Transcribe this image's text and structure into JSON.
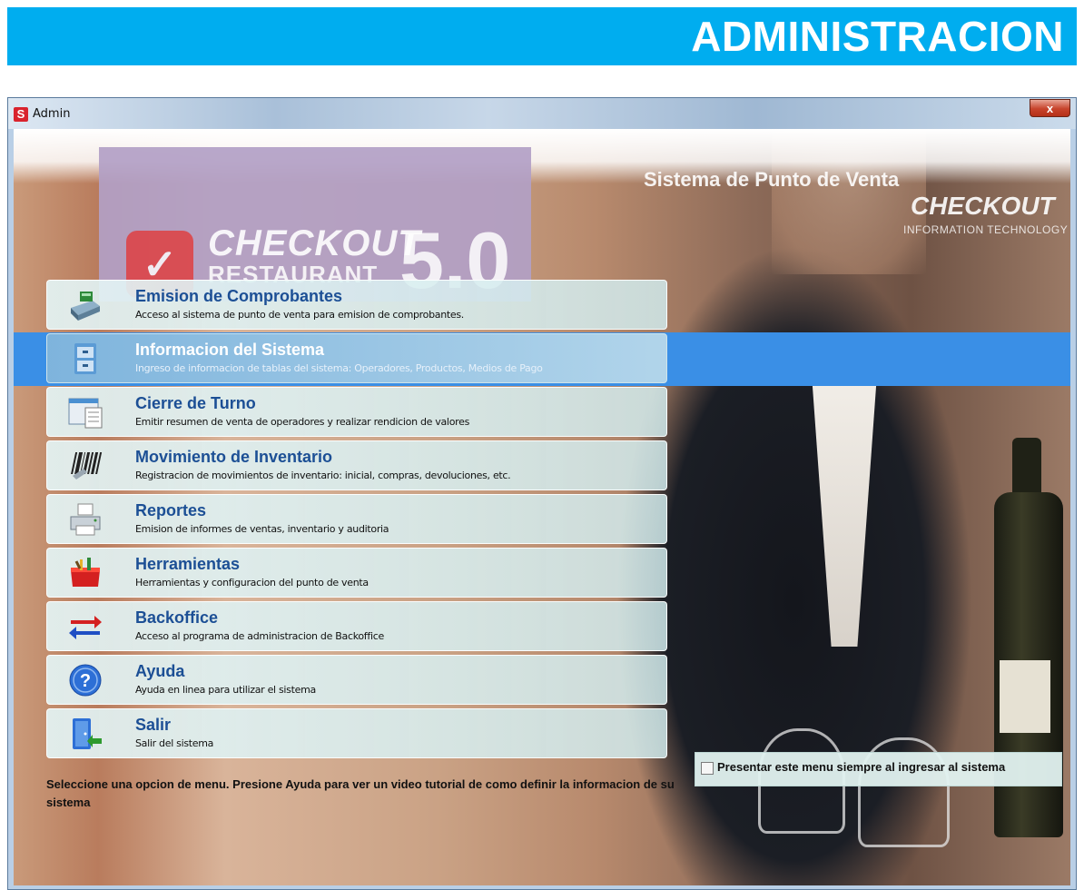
{
  "banner": {
    "title": "ADMINISTRACION"
  },
  "window": {
    "title": "Admin",
    "app_icon": "S",
    "close_label": "x"
  },
  "brand": {
    "logo_main": "CHECKOUT",
    "logo_sub": "RESTAURANT",
    "logo_version": "5.0",
    "tagline": "Sistema de Punto de Venta",
    "corner_brand": "CHECKOUT",
    "corner_sub": "INFORMATION TECHNOLOGY"
  },
  "menu": {
    "selected_index": 1,
    "items": [
      {
        "title": "Emision de Comprobantes",
        "desc": "Acceso al sistema de punto de venta para emision de comprobantes.",
        "icon": "cash-register-icon"
      },
      {
        "title": "Informacion del Sistema",
        "desc": "Ingreso de informacion de tablas del sistema: Operadores, Productos, Medios de Pago",
        "icon": "file-cabinet-icon"
      },
      {
        "title": "Cierre de Turno",
        "desc": "Emitir resumen de venta de operadores y realizar rendicion de valores",
        "icon": "report-window-icon"
      },
      {
        "title": "Movimiento de Inventario",
        "desc": "Registracion de movimientos de inventario: inicial, compras, devoluciones, etc.",
        "icon": "barcode-icon"
      },
      {
        "title": "Reportes",
        "desc": "Emision de informes de ventas, inventario y auditoria",
        "icon": "printer-icon"
      },
      {
        "title": "Herramientas",
        "desc": "Herramientas y configuracion del punto de venta",
        "icon": "toolbox-icon"
      },
      {
        "title": "Backoffice",
        "desc": "Acceso al programa de administracion de Backoffice",
        "icon": "transfer-arrows-icon"
      },
      {
        "title": "Ayuda",
        "desc": "Ayuda en linea para utilizar el sistema",
        "icon": "help-icon"
      },
      {
        "title": "Salir",
        "desc": "Salir del sistema",
        "icon": "exit-door-icon"
      }
    ]
  },
  "settings": {
    "show_menu_label": "Presentar este menu siempre al ingresar al sistema",
    "show_menu_checked": false
  },
  "footer": {
    "instruction": "Seleccione una opcion de menu. Presione Ayuda para ver un video tutorial de como definir la informacion de su sistema"
  },
  "colors": {
    "banner": "#00adef",
    "selected_row": "#3a8fe6",
    "menu_title": "#1c4f95"
  }
}
